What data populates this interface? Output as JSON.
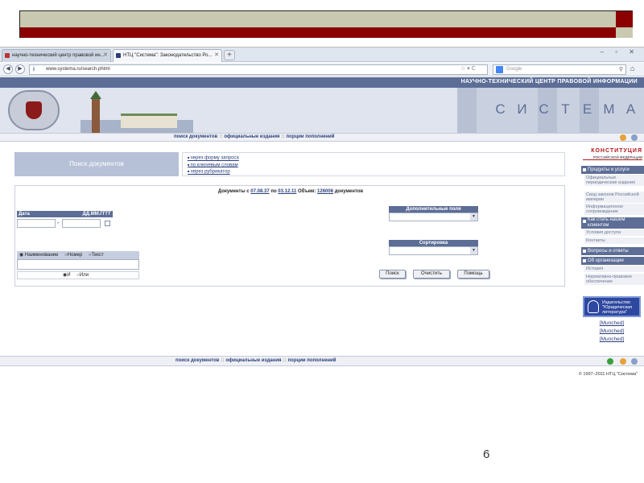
{
  "browser": {
    "tabs": [
      {
        "label": "научно-технический центр правовой ин..."
      },
      {
        "label": "НТЦ \"Система\": Законодательство Ро..."
      }
    ],
    "new_tab": "+",
    "window_controls": "– ▫ ✕",
    "url": "www.systema.ru/search.phtml",
    "search_placeholder": "Google"
  },
  "site": {
    "top_title": "НАУЧНО-ТЕХНИЧЕСКИЙ ЦЕНТР ПРАВОВОЙ ИНФОРМАЦИИ",
    "brand_letters": [
      "С",
      "И",
      "С",
      "Т",
      "Е",
      "М",
      "А"
    ],
    "menu": [
      "поиск документов",
      "официальные издания",
      "порции пополнений"
    ],
    "menu_sep": "::"
  },
  "search": {
    "header": "Поиск документов",
    "ways": [
      "через форму запроса",
      "по ключевым словам",
      "через рубрикатор"
    ],
    "docs_prefix": "Документы с",
    "date_from": "07.08.37",
    "docs_po": "по",
    "date_to": "03.12.11",
    "volume_label": "Объем:",
    "volume": "126006",
    "docs_suffix": "документов",
    "date_label": "Дата",
    "date_format": "ДД.ММ.ГГГГ",
    "dash": "-",
    "radio_name": "Наименование",
    "radio_number": "Номер",
    "radio_text": "Текст",
    "and_label": "И",
    "or_label": "Или",
    "extra_fields_label": "Дополнительные поля",
    "sort_label": "Сортировка",
    "btn_search": "Поиск",
    "btn_clear": "Очистить",
    "btn_help": "Помощь"
  },
  "sidebar": {
    "konst": "КОНСТИТУЦИЯ",
    "konst_sub": "РОССИЙСКОЙ ФЕДЕРАЦИИ",
    "products_header": "Продукты и услуги",
    "products": [
      "Официальные периодические издания",
      "Свод законов Российской империи",
      "Информационное сопровождение"
    ],
    "clients_header": "Как стать нашим клиентом",
    "clients": [
      "Условия доступа",
      "Контакты"
    ],
    "qa_header": "Вопросы и ответы",
    "org_header": "Об организации",
    "org": [
      "История",
      "Нормативно-правовое обеспечение"
    ],
    "publisher": "Издательство \"Юридическая литература\"",
    "munched": [
      "[Munched]",
      "[Munched]",
      "[Munched]"
    ]
  },
  "footer": {
    "copyright": "© 1997–2011 НТЦ \"Система\""
  },
  "slide": {
    "page_number": "6"
  }
}
